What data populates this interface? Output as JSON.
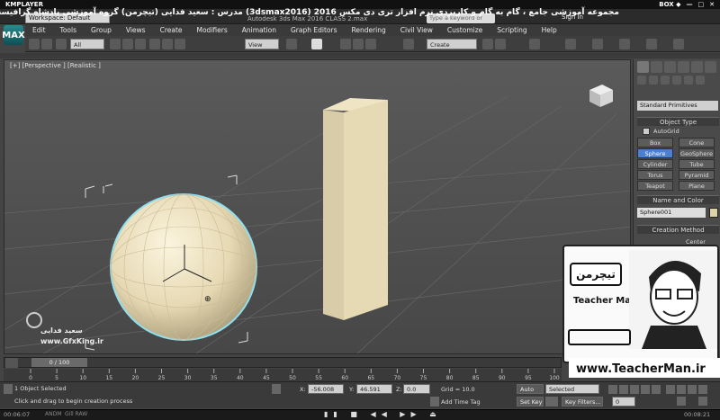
{
  "player": {
    "name": "KMPLAYER",
    "right_label": "BOX ◆",
    "time_elapsed": "00:06:07",
    "time_total": "00:08:21",
    "sub_left": "ANDM",
    "sub_mid": "Gill RAW"
  },
  "banner": {
    "text": "مجموعه آموزشی جامع ، گام به گام و کاربردی نرم افزار تری دی مکس 2016 (3dsmax2016) مدرس : سعید فدایی (تیچرمن) گروه آموزشی پادشاه گرافیست ها"
  },
  "titlebar": {
    "logo": "MAX",
    "workspace": "Workspace: Default",
    "app_title": "Autodesk 3ds Max 2016     CLASS 2.max",
    "search_placeholder": "Type a keyword or phrase",
    "signin": "Sign In"
  },
  "menu": [
    "Edit",
    "Tools",
    "Group",
    "Views",
    "Create",
    "Modifiers",
    "Animation",
    "Graph Editors",
    "Rendering",
    "Civil View",
    "Customize",
    "Scripting",
    "Help"
  ],
  "toolbar": {
    "filter": "All",
    "coord": "View",
    "selection_set": "Create Selection Se"
  },
  "viewport": {
    "label": "[+] [Perspective ] [Realistic ]",
    "watermark_name": "سعید فدایی",
    "watermark_site": "www.GfxKing.ir"
  },
  "command_panel": {
    "category": "Standard Primitives",
    "object_type_title": "Object Type",
    "autogrid": "AutoGrid",
    "buttons": [
      {
        "label": "Box",
        "selected": false
      },
      {
        "label": "Cone",
        "selected": false
      },
      {
        "label": "Sphere",
        "selected": true
      },
      {
        "label": "GeoSphere",
        "selected": false
      },
      {
        "label": "Cylinder",
        "selected": false
      },
      {
        "label": "Tube",
        "selected": false
      },
      {
        "label": "Torus",
        "selected": false
      },
      {
        "label": "Pyramid",
        "selected": false
      },
      {
        "label": "Teapot",
        "selected": false
      },
      {
        "label": "Plane",
        "selected": false
      }
    ],
    "name_color_title": "Name and Color",
    "object_name": "Sphere001",
    "creation_method_title": "Creation Method",
    "creation_option": "Center"
  },
  "teacher": {
    "logo_text": "تیچرمن",
    "title": "Teacher Man",
    "url": "www.TeacherMan.ir"
  },
  "timeline": {
    "frame": "0 / 100",
    "ticks": [
      "0",
      "5",
      "10",
      "15",
      "20",
      "25",
      "30",
      "35",
      "40",
      "45",
      "50",
      "55",
      "60",
      "65",
      "70",
      "75",
      "80",
      "85",
      "90",
      "95",
      "100"
    ]
  },
  "status": {
    "selected": "1 Object Selected",
    "prompt": "Click and drag to begin creation process",
    "x_label": "X:",
    "x": "-56.008",
    "y_label": "Y:",
    "y": "46.591",
    "z_label": "Z:",
    "z": "0.0",
    "grid": "Grid = 10.0",
    "add_time_tag": "Add Time Tag",
    "auto_key": "Auto Key",
    "set_key": "Set Key",
    "selected_dropdown": "Selected",
    "key_filters": "Key Filters...",
    "frame_field": "0"
  },
  "colors": {
    "accent_selected": "#4b7fd1",
    "object_color": "#ddd1a8",
    "viewport_bg": "#505050"
  }
}
